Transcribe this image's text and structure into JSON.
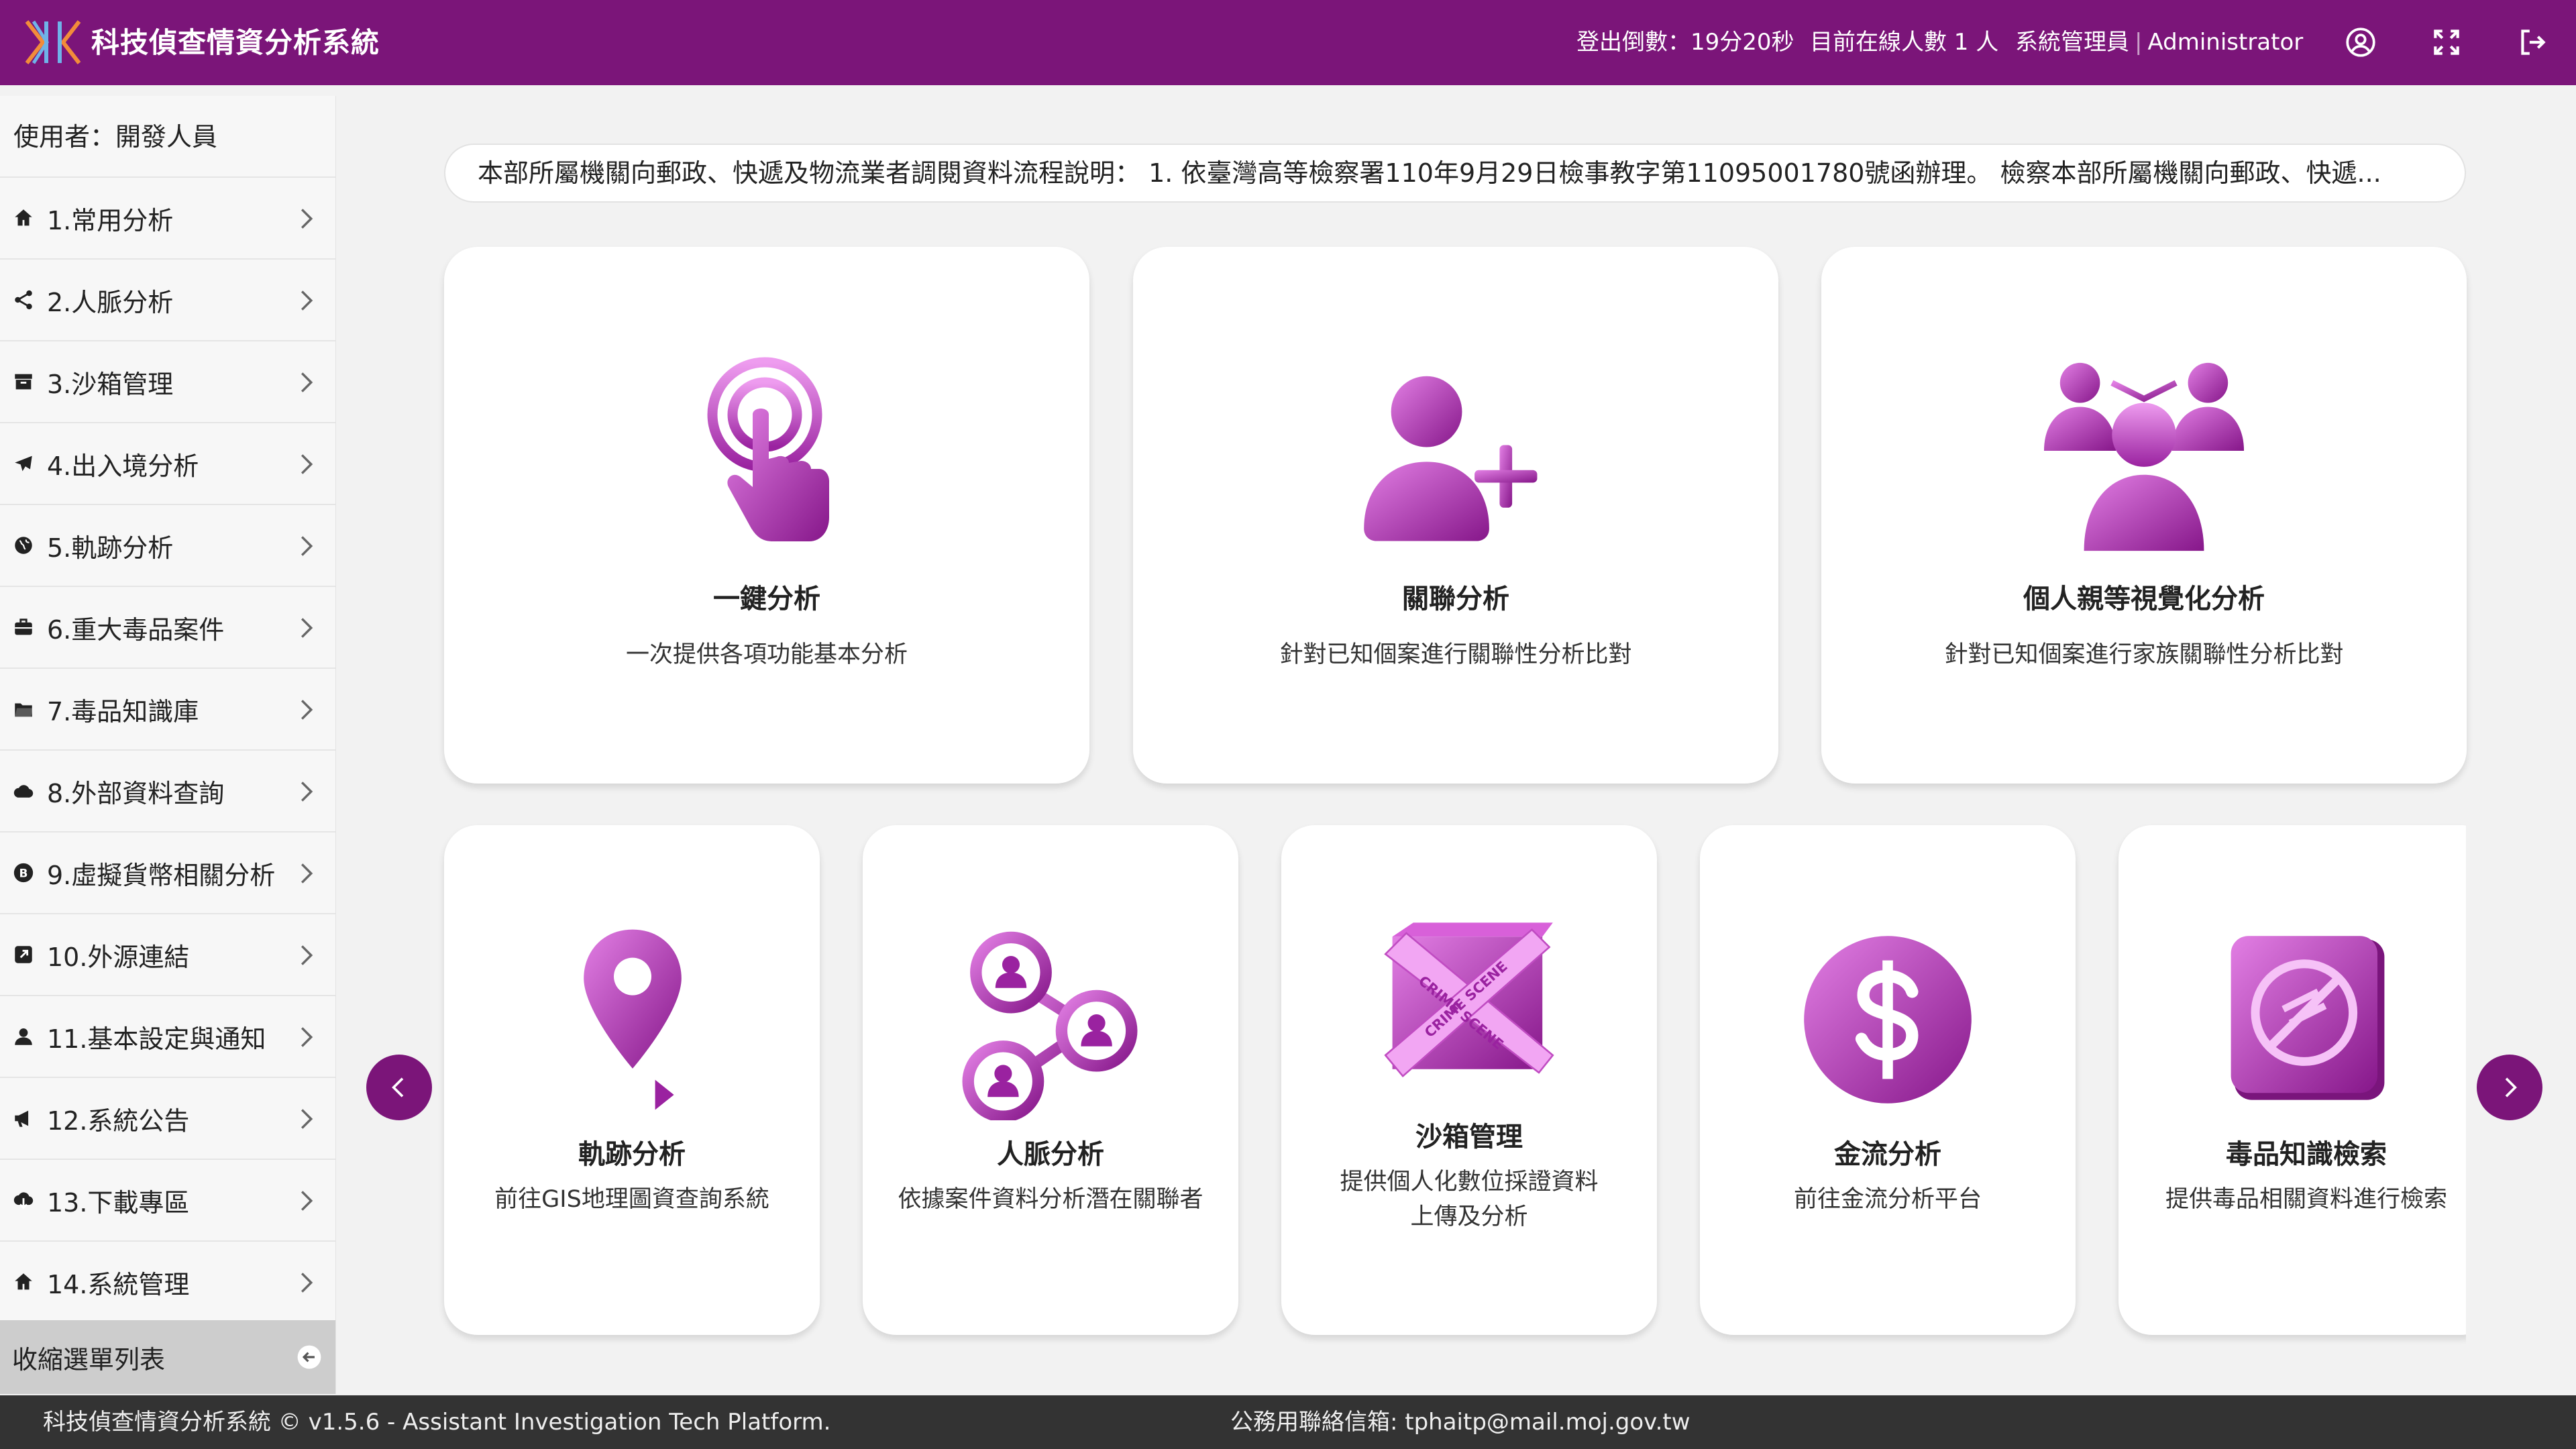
{
  "header": {
    "title": "科技偵查情資分析系統",
    "countdown": "登出倒數：19分20秒",
    "online": "目前在線人數 1 人",
    "role": "系統管理員",
    "user": "Administrator",
    "color": "#7b1579"
  },
  "sidebar": {
    "user": "使用者：開發人員",
    "items": [
      {
        "label": "1.常用分析",
        "icon": "home-icon"
      },
      {
        "label": "2.人脈分析",
        "icon": "share-icon"
      },
      {
        "label": "3.沙箱管理",
        "icon": "archive-icon"
      },
      {
        "label": "4.出入境分析",
        "icon": "plane-icon"
      },
      {
        "label": "5.軌跡分析",
        "icon": "globe-icon"
      },
      {
        "label": "6.重大毒品案件",
        "icon": "briefcase-icon"
      },
      {
        "label": "7.毒品知識庫",
        "icon": "folder-icon"
      },
      {
        "label": "8.外部資料查詢",
        "icon": "cloud-icon"
      },
      {
        "label": "9.虛擬貨幣相關分析",
        "icon": "bitcoin-icon"
      },
      {
        "label": "10.外源連結",
        "icon": "external-link-icon"
      },
      {
        "label": "11.基本設定與通知",
        "icon": "user-icon"
      },
      {
        "label": "12.系統公告",
        "icon": "megaphone-icon"
      },
      {
        "label": "13.下載專區",
        "icon": "cloud-download-icon"
      },
      {
        "label": "14.系統管理",
        "icon": "home-icon"
      }
    ],
    "collapse": "收縮選單列表"
  },
  "marquee": "本部所屬機關向郵政、快遞及物流業者調閱資料流程說明： 1. 依臺灣高等檢察署110年9月29日檢事教字第11095001780號函辦理。 檢察本部所屬機關向郵政、快遞...",
  "cards_top": [
    {
      "title": "一鍵分析",
      "desc": "一次提供各項功能基本分析",
      "icon": "tap-icon"
    },
    {
      "title": "關聯分析",
      "desc": "針對已知個案進行關聯性分析比對",
      "icon": "add-user-icon"
    },
    {
      "title": "個人親等視覺化分析",
      "desc": "針對已知個案進行家族關聯性分析比對",
      "icon": "family-icon"
    }
  ],
  "cards_bottom": [
    {
      "title": "軌跡分析",
      "desc": "前往GIS地理圖資查詢系統",
      "icon": "map-pin-icon"
    },
    {
      "title": "人脈分析",
      "desc": "依據案件資料分析潛在關聯者",
      "icon": "network-icon"
    },
    {
      "title": "沙箱管理",
      "desc1": "提供個人化數位採證資料",
      "desc2": "上傳及分析",
      "icon": "crime-scene-icon",
      "tape_text": "CRIME SCENE"
    },
    {
      "title": "金流分析",
      "desc": "前往金流分析平台",
      "icon": "dollar-icon"
    },
    {
      "title": "毒品知識檢索",
      "desc": "提供毒品相關資料進行檢索",
      "icon": "no-drugs-icon"
    }
  ],
  "footer": {
    "left": "科技偵查情資分析系統 © v1.5.6 - Assistant Investigation Tech Platform.",
    "right": "公務用聯絡信箱: tphaitp@mail.moj.gov.tw"
  },
  "colors": {
    "accent": "#7b1579",
    "icon_grad_light": "#e27fe4",
    "icon_grad_dark": "#8a1a8c"
  }
}
